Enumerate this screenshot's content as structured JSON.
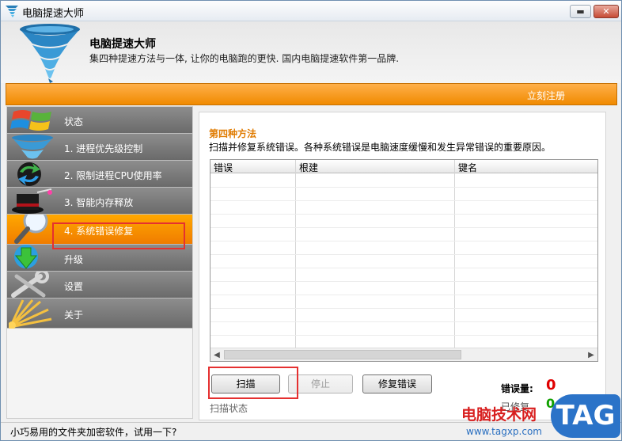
{
  "window": {
    "title": "电脑提速大师",
    "min_label": "▬",
    "max_label": "▣",
    "close_label": "✕"
  },
  "header": {
    "product_name": "电脑提速大师",
    "slogan": "集四种提速方法与一体, 让你的电脑跑的更快. 国内电脑提速软件第一品牌."
  },
  "topbar": {
    "register_label": "立刻注册"
  },
  "sidebar": {
    "items": [
      {
        "label": "状态",
        "icon": "windows-logo-icon"
      },
      {
        "label": "1. 进程优先级控制",
        "icon": "tornado-icon"
      },
      {
        "label": "2. 限制进程CPU使用率",
        "icon": "refresh-arrows-icon"
      },
      {
        "label": "3. 智能内存释放",
        "icon": "magic-hat-icon"
      },
      {
        "label": "4. 系统错误修复",
        "icon": "magnifier-icon",
        "active": true
      },
      {
        "label": "升级",
        "icon": "download-arrow-icon"
      },
      {
        "label": "设置",
        "icon": "wrench-icon"
      },
      {
        "label": "关于",
        "icon": "sun-rays-icon"
      }
    ]
  },
  "main": {
    "method_title": "第四种方法",
    "method_desc": "扫描并修复系统错误。各种系统错误是电脑速度缓慢和发生异常错误的重要原因。",
    "table": {
      "columns": [
        "错误",
        "根建",
        "键名"
      ],
      "rows": []
    },
    "buttons": {
      "scan": "扫描",
      "stop": "停止",
      "repair": "修复错误"
    },
    "scan_status": "扫描状态",
    "error_count_label": "错误量:",
    "error_count": "0",
    "fixed_label": "已修复",
    "fixed_count": "0"
  },
  "statusbar": {
    "message": "小巧易用的文件夹加密软件，试用一下?"
  },
  "watermark": {
    "text": "电脑技术网",
    "url": "www.tagxp.com",
    "badge": "TAG"
  },
  "colors": {
    "accent_orange": "#f08a00",
    "nav_gray": "#7a7a7a",
    "error_red": "#e00000",
    "fixed_green": "#11a000",
    "highlight_red": "#e53030"
  }
}
